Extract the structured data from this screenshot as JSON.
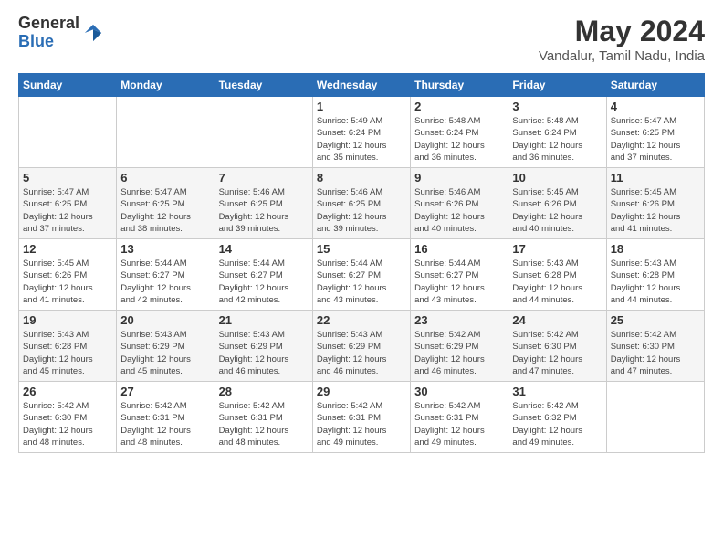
{
  "logo": {
    "general": "General",
    "blue": "Blue"
  },
  "header": {
    "month_year": "May 2024",
    "location": "Vandalur, Tamil Nadu, India"
  },
  "weekdays": [
    "Sunday",
    "Monday",
    "Tuesday",
    "Wednesday",
    "Thursday",
    "Friday",
    "Saturday"
  ],
  "weeks": [
    [
      {
        "day": "",
        "info": ""
      },
      {
        "day": "",
        "info": ""
      },
      {
        "day": "",
        "info": ""
      },
      {
        "day": "1",
        "info": "Sunrise: 5:49 AM\nSunset: 6:24 PM\nDaylight: 12 hours\nand 35 minutes."
      },
      {
        "day": "2",
        "info": "Sunrise: 5:48 AM\nSunset: 6:24 PM\nDaylight: 12 hours\nand 36 minutes."
      },
      {
        "day": "3",
        "info": "Sunrise: 5:48 AM\nSunset: 6:24 PM\nDaylight: 12 hours\nand 36 minutes."
      },
      {
        "day": "4",
        "info": "Sunrise: 5:47 AM\nSunset: 6:25 PM\nDaylight: 12 hours\nand 37 minutes."
      }
    ],
    [
      {
        "day": "5",
        "info": "Sunrise: 5:47 AM\nSunset: 6:25 PM\nDaylight: 12 hours\nand 37 minutes."
      },
      {
        "day": "6",
        "info": "Sunrise: 5:47 AM\nSunset: 6:25 PM\nDaylight: 12 hours\nand 38 minutes."
      },
      {
        "day": "7",
        "info": "Sunrise: 5:46 AM\nSunset: 6:25 PM\nDaylight: 12 hours\nand 39 minutes."
      },
      {
        "day": "8",
        "info": "Sunrise: 5:46 AM\nSunset: 6:25 PM\nDaylight: 12 hours\nand 39 minutes."
      },
      {
        "day": "9",
        "info": "Sunrise: 5:46 AM\nSunset: 6:26 PM\nDaylight: 12 hours\nand 40 minutes."
      },
      {
        "day": "10",
        "info": "Sunrise: 5:45 AM\nSunset: 6:26 PM\nDaylight: 12 hours\nand 40 minutes."
      },
      {
        "day": "11",
        "info": "Sunrise: 5:45 AM\nSunset: 6:26 PM\nDaylight: 12 hours\nand 41 minutes."
      }
    ],
    [
      {
        "day": "12",
        "info": "Sunrise: 5:45 AM\nSunset: 6:26 PM\nDaylight: 12 hours\nand 41 minutes."
      },
      {
        "day": "13",
        "info": "Sunrise: 5:44 AM\nSunset: 6:27 PM\nDaylight: 12 hours\nand 42 minutes."
      },
      {
        "day": "14",
        "info": "Sunrise: 5:44 AM\nSunset: 6:27 PM\nDaylight: 12 hours\nand 42 minutes."
      },
      {
        "day": "15",
        "info": "Sunrise: 5:44 AM\nSunset: 6:27 PM\nDaylight: 12 hours\nand 43 minutes."
      },
      {
        "day": "16",
        "info": "Sunrise: 5:44 AM\nSunset: 6:27 PM\nDaylight: 12 hours\nand 43 minutes."
      },
      {
        "day": "17",
        "info": "Sunrise: 5:43 AM\nSunset: 6:28 PM\nDaylight: 12 hours\nand 44 minutes."
      },
      {
        "day": "18",
        "info": "Sunrise: 5:43 AM\nSunset: 6:28 PM\nDaylight: 12 hours\nand 44 minutes."
      }
    ],
    [
      {
        "day": "19",
        "info": "Sunrise: 5:43 AM\nSunset: 6:28 PM\nDaylight: 12 hours\nand 45 minutes."
      },
      {
        "day": "20",
        "info": "Sunrise: 5:43 AM\nSunset: 6:29 PM\nDaylight: 12 hours\nand 45 minutes."
      },
      {
        "day": "21",
        "info": "Sunrise: 5:43 AM\nSunset: 6:29 PM\nDaylight: 12 hours\nand 46 minutes."
      },
      {
        "day": "22",
        "info": "Sunrise: 5:43 AM\nSunset: 6:29 PM\nDaylight: 12 hours\nand 46 minutes."
      },
      {
        "day": "23",
        "info": "Sunrise: 5:42 AM\nSunset: 6:29 PM\nDaylight: 12 hours\nand 46 minutes."
      },
      {
        "day": "24",
        "info": "Sunrise: 5:42 AM\nSunset: 6:30 PM\nDaylight: 12 hours\nand 47 minutes."
      },
      {
        "day": "25",
        "info": "Sunrise: 5:42 AM\nSunset: 6:30 PM\nDaylight: 12 hours\nand 47 minutes."
      }
    ],
    [
      {
        "day": "26",
        "info": "Sunrise: 5:42 AM\nSunset: 6:30 PM\nDaylight: 12 hours\nand 48 minutes."
      },
      {
        "day": "27",
        "info": "Sunrise: 5:42 AM\nSunset: 6:31 PM\nDaylight: 12 hours\nand 48 minutes."
      },
      {
        "day": "28",
        "info": "Sunrise: 5:42 AM\nSunset: 6:31 PM\nDaylight: 12 hours\nand 48 minutes."
      },
      {
        "day": "29",
        "info": "Sunrise: 5:42 AM\nSunset: 6:31 PM\nDaylight: 12 hours\nand 49 minutes."
      },
      {
        "day": "30",
        "info": "Sunrise: 5:42 AM\nSunset: 6:31 PM\nDaylight: 12 hours\nand 49 minutes."
      },
      {
        "day": "31",
        "info": "Sunrise: 5:42 AM\nSunset: 6:32 PM\nDaylight: 12 hours\nand 49 minutes."
      },
      {
        "day": "",
        "info": ""
      }
    ]
  ]
}
